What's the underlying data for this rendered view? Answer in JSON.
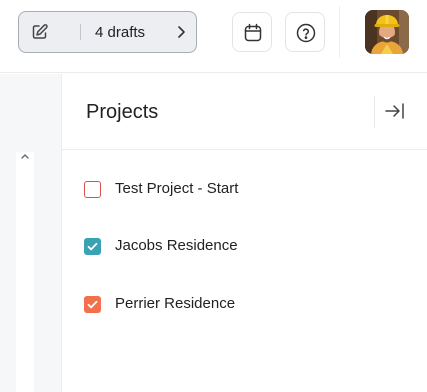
{
  "topbar": {
    "drafts_label": "4 drafts",
    "icons": {
      "edit": "edit-icon",
      "chevron": "chevron-right-icon",
      "calendar": "calendar-icon",
      "help": "help-circle-icon",
      "avatar": "user-avatar"
    }
  },
  "panel": {
    "title": "Projects",
    "collapse_icon": "collapse-right-icon"
  },
  "projects": [
    {
      "label": "Test Project - Start",
      "checked": false,
      "color": "#d9534f"
    },
    {
      "label": "Jacobs Residence",
      "checked": true,
      "color": "#3aa2b5"
    },
    {
      "label": "Perrier Residence",
      "checked": true,
      "color": "#f2704c"
    }
  ],
  "colors": {
    "drafts_bg": "#eceef1",
    "drafts_border": "#a8adb4",
    "rail_bg": "#f6f7f9"
  }
}
